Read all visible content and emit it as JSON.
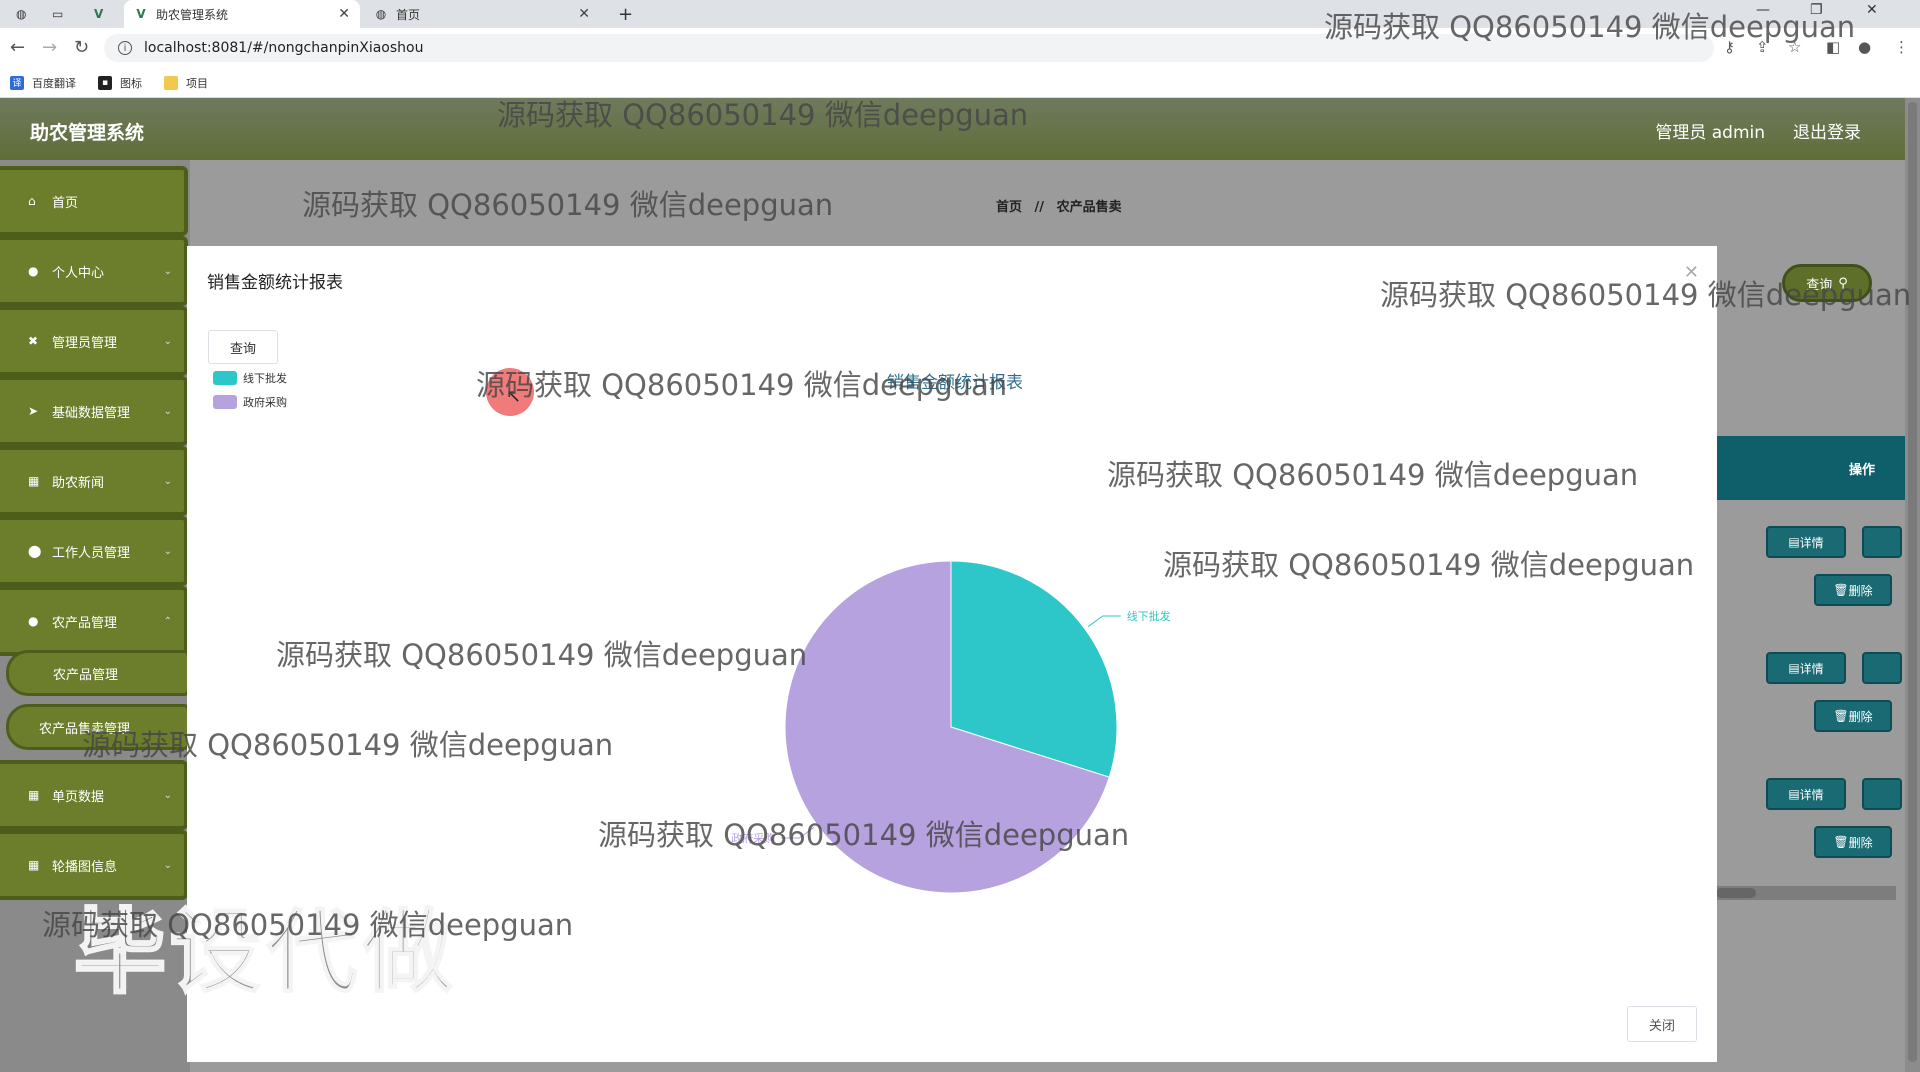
{
  "browser": {
    "tabs": [
      {
        "title": "助农管理系统",
        "active": true
      },
      {
        "title": "首页",
        "active": false
      }
    ],
    "new_tab": "+",
    "url": "localhost:8081/#/nongchanpinXiaoshou",
    "bookmarks": [
      {
        "label": "百度翻译",
        "color": "#2d6bd8"
      },
      {
        "label": "图标",
        "color": "#222222"
      },
      {
        "label": "项目",
        "color": "#f2c94c"
      }
    ]
  },
  "app": {
    "title": "助农管理系统",
    "admin": "管理员 admin",
    "logout": "退出登录",
    "sidebar": {
      "items": [
        {
          "label": "首页",
          "icon": "home-icon"
        },
        {
          "label": "个人中心",
          "icon": "user-icon"
        },
        {
          "label": "管理员管理",
          "icon": "admin-icon"
        },
        {
          "label": "基础数据管理",
          "icon": "send-icon"
        },
        {
          "label": "助农新闻",
          "icon": "grid-icon"
        },
        {
          "label": "工作人员管理",
          "icon": "location-icon"
        },
        {
          "label": "农产品管理",
          "icon": "user-icon"
        }
      ],
      "sub_items": [
        "农产品管理",
        "农产品售卖管理"
      ],
      "bottom_items": [
        {
          "label": "单页数据",
          "icon": "grid-icon"
        },
        {
          "label": "轮播图信息",
          "icon": "grid-icon"
        }
      ]
    },
    "breadcrumb": {
      "home": "首页",
      "separator": "//",
      "current": "农产品售卖"
    },
    "search_button": "查询",
    "table": {
      "action_header": "操作",
      "detail_label": "详情",
      "delete_label": "删除"
    }
  },
  "modal": {
    "title": "销售金额统计报表",
    "query_button": "查询",
    "close_button": "关闭",
    "close_icon": "close-icon"
  },
  "chart_data": {
    "type": "pie",
    "title": "销售金额统计报表",
    "legend_position": "top-left",
    "slices": [
      {
        "name": "线下批发",
        "value": 26,
        "color": "#2ec7c9"
      },
      {
        "name": "政府采购",
        "value": 61,
        "color": "#b6a2de"
      }
    ]
  },
  "watermarks": {
    "text": "源码获取 QQ86050149 微信deepguan",
    "stamp": "毕设代做"
  }
}
